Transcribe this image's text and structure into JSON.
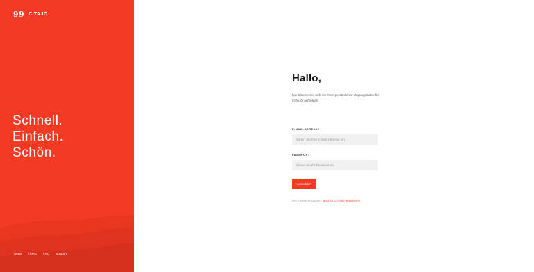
{
  "brand": {
    "name": "CITAJO",
    "mark": "99",
    "color": "#f23b22"
  },
  "tagline": [
    "Schnell.",
    "Einfach.",
    "Schön."
  ],
  "footer_links": [
    "News",
    "Lizenz",
    "FAQ",
    "Support"
  ],
  "login": {
    "title": "Hallo,",
    "intro": "hier können Sie sich mit Ihren persönlichen Zugangsdaten für CITAJO anmelden.",
    "email_label": "E-Mail-Adresse",
    "email_placeholder": "Geben Sie Ihre E-Mail-Adresse ein",
    "password_label": "Passwort",
    "password_placeholder": "Geben Sie Ihr Passwort ein",
    "submit_label": "Anmelden",
    "register_prefix": "Noch keinen Account?",
    "register_link": "Jetzt für CITAJO registrieren"
  }
}
